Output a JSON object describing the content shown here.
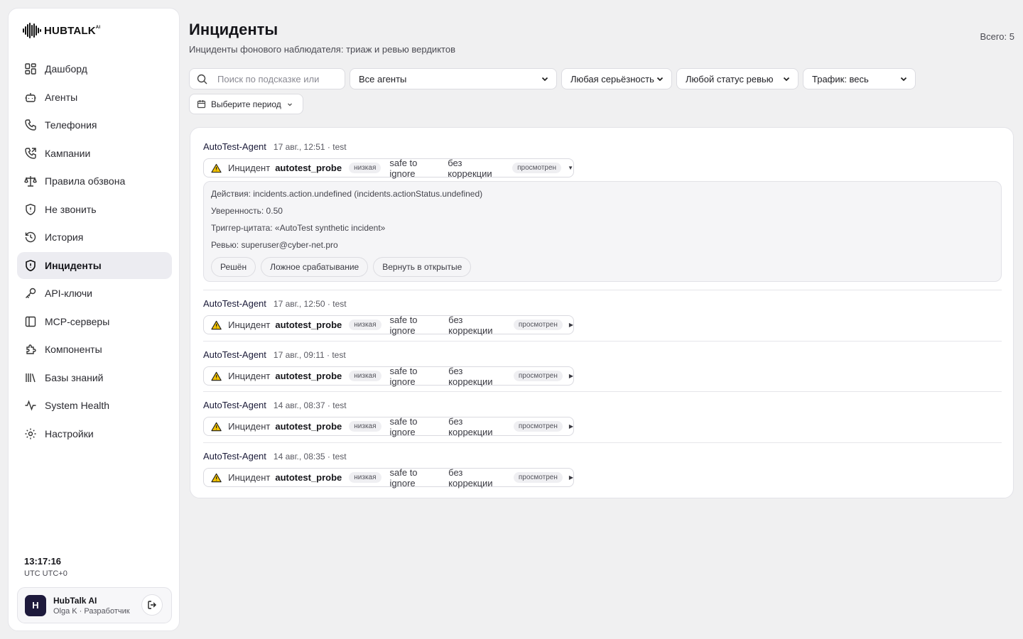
{
  "brand": {
    "name": "HUBTALK",
    "suffix": "AI"
  },
  "sidebar": {
    "items": [
      {
        "label": "Дашборд",
        "icon": "dashboard-icon"
      },
      {
        "label": "Агенты",
        "icon": "bot-icon"
      },
      {
        "label": "Телефония",
        "icon": "phone-icon"
      },
      {
        "label": "Кампании",
        "icon": "phone-outgoing-icon"
      },
      {
        "label": "Правила обзвона",
        "icon": "scale-icon"
      },
      {
        "label": "Не звонить",
        "icon": "shield-icon"
      },
      {
        "label": "История",
        "icon": "history-icon"
      },
      {
        "label": "Инциденты",
        "icon": "shield-alert-icon",
        "active": true
      },
      {
        "label": "API-ключи",
        "icon": "key-icon"
      },
      {
        "label": "MCP-серверы",
        "icon": "panel-icon"
      },
      {
        "label": "Компоненты",
        "icon": "puzzle-icon"
      },
      {
        "label": "Базы знаний",
        "icon": "library-icon"
      },
      {
        "label": "System Health",
        "icon": "activity-icon"
      },
      {
        "label": "Настройки",
        "icon": "gear-icon"
      }
    ],
    "clock": {
      "time": "13:17:16",
      "tz": "UTC UTC+0"
    },
    "user": {
      "initial": "H",
      "name": "HubTalk AI",
      "role": "Olga K · Разработчик"
    }
  },
  "header": {
    "title": "Инциденты",
    "subtitle": "Инциденты фонового наблюдателя: триаж и ревью вердиктов",
    "total": "Всего: 5"
  },
  "filters": {
    "search_placeholder": "Поиск по подсказке или",
    "agent": "Все агенты",
    "severity": "Любая серьёзность",
    "review": "Любой статус ревью",
    "traffic": "Трафик: весь",
    "period": "Выберите период"
  },
  "incidents": [
    {
      "agent": "AutoTest-Agent",
      "meta": "17 авг., 12:51 · test",
      "kind": "Инцидент",
      "code": "autotest_probe",
      "severity": "низкая",
      "verdict": "safe to ignore",
      "correction": "без коррекции",
      "review": "просмотрен",
      "expanded": true,
      "details": {
        "actions": "Действия: incidents.action.undefined (incidents.actionStatus.undefined)",
        "confidence": "Уверенность: 0.50",
        "trigger": "Триггер-цитата: «AutoTest synthetic incident»",
        "reviewer": "Ревью: superuser@cyber-net.pro"
      },
      "buttons": {
        "resolved": "Решён",
        "false_positive": "Ложное срабатывание",
        "reopen": "Вернуть в открытые"
      }
    },
    {
      "agent": "AutoTest-Agent",
      "meta": "17 авг., 12:50 · test",
      "kind": "Инцидент",
      "code": "autotest_probe",
      "severity": "низкая",
      "verdict": "safe to ignore",
      "correction": "без коррекции",
      "review": "просмотрен"
    },
    {
      "agent": "AutoTest-Agent",
      "meta": "17 авг., 09:11 · test",
      "kind": "Инцидент",
      "code": "autotest_probe",
      "severity": "низкая",
      "verdict": "safe to ignore",
      "correction": "без коррекции",
      "review": "просмотрен"
    },
    {
      "agent": "AutoTest-Agent",
      "meta": "14 авг., 08:37 · test",
      "kind": "Инцидент",
      "code": "autotest_probe",
      "severity": "низкая",
      "verdict": "safe to ignore",
      "correction": "без коррекции",
      "review": "просмотрен"
    },
    {
      "agent": "AutoTest-Agent",
      "meta": "14 авг., 08:35 · test",
      "kind": "Инцидент",
      "code": "autotest_probe",
      "severity": "низкая",
      "verdict": "safe to ignore",
      "correction": "без коррекции",
      "review": "просмотрен"
    }
  ],
  "colors": {
    "accent_dark": "#1e1a3c",
    "active_bg": "#ececf1",
    "warning": "#f2c200"
  }
}
